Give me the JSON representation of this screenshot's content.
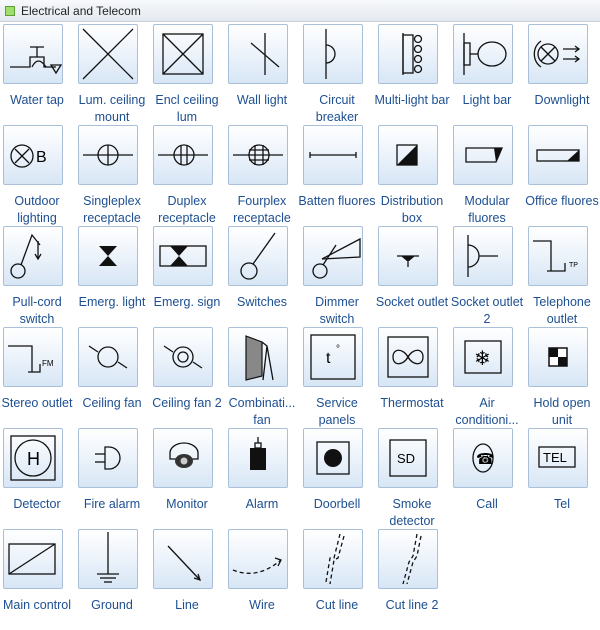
{
  "panel": {
    "title": "Electrical and Telecom"
  },
  "shapes": [
    {
      "label": "Water tap",
      "icon": "water-tap-icon"
    },
    {
      "label": "Lum. ceiling mount",
      "icon": "ceiling-mount-icon"
    },
    {
      "label": "Encl ceiling lum",
      "icon": "enclosed-ceiling-icon"
    },
    {
      "label": "Wall light",
      "icon": "wall-light-icon"
    },
    {
      "label": "Circuit breaker",
      "icon": "circuit-breaker-icon"
    },
    {
      "label": "Multi-light bar",
      "icon": "multi-light-bar-icon"
    },
    {
      "label": "Light bar",
      "icon": "light-bar-icon"
    },
    {
      "label": "Downlight",
      "icon": "downlight-icon"
    },
    {
      "label": "Outdoor lighting",
      "icon": "outdoor-lighting-icon"
    },
    {
      "label": "Singleplex receptacle",
      "icon": "singleplex-receptacle-icon"
    },
    {
      "label": "Duplex receptacle",
      "icon": "duplex-receptacle-icon"
    },
    {
      "label": "Fourplex receptacle",
      "icon": "fourplex-receptacle-icon"
    },
    {
      "label": "Batten fluores",
      "icon": "batten-fluores-icon"
    },
    {
      "label": "Distribution box",
      "icon": "distribution-box-icon"
    },
    {
      "label": "Modular fluores",
      "icon": "modular-fluores-icon"
    },
    {
      "label": "Office fluores",
      "icon": "office-fluores-icon"
    },
    {
      "label": "Pull-cord switch",
      "icon": "pull-cord-switch-icon"
    },
    {
      "label": "Emerg. light",
      "icon": "emergency-light-icon"
    },
    {
      "label": "Emerg. sign",
      "icon": "emergency-sign-icon"
    },
    {
      "label": "Switches",
      "icon": "switches-icon"
    },
    {
      "label": "Dimmer switch",
      "icon": "dimmer-switch-icon"
    },
    {
      "label": "Socket outlet",
      "icon": "socket-outlet-icon"
    },
    {
      "label": "Socket outlet 2",
      "icon": "socket-outlet-2-icon"
    },
    {
      "label": "Telephone outlet",
      "icon": "telephone-outlet-icon",
      "text": "TP"
    },
    {
      "label": "Stereo outlet",
      "icon": "stereo-outlet-icon",
      "text": "FM"
    },
    {
      "label": "Ceiling fan",
      "icon": "ceiling-fan-icon"
    },
    {
      "label": "Ceiling fan 2",
      "icon": "ceiling-fan-2-icon"
    },
    {
      "label": "Combinati... fan",
      "icon": "combination-fan-icon"
    },
    {
      "label": "Service panels",
      "icon": "service-panels-icon",
      "text": "t",
      "text2": "°"
    },
    {
      "label": "Thermostat",
      "icon": "thermostat-icon"
    },
    {
      "label": "Air conditioni...",
      "icon": "air-conditioning-icon",
      "text": "❄"
    },
    {
      "label": "Hold open unit",
      "icon": "hold-open-unit-icon"
    },
    {
      "label": "Detector",
      "icon": "detector-icon",
      "text": "H"
    },
    {
      "label": "Fire alarm",
      "icon": "fire-alarm-icon"
    },
    {
      "label": "Monitor",
      "icon": "monitor-icon"
    },
    {
      "label": "Alarm",
      "icon": "alarm-icon"
    },
    {
      "label": "Doorbell",
      "icon": "doorbell-icon"
    },
    {
      "label": "Smoke detector",
      "icon": "smoke-detector-icon",
      "text": "SD"
    },
    {
      "label": "Call",
      "icon": "call-icon",
      "text": "☎"
    },
    {
      "label": "Tel",
      "icon": "tel-icon",
      "text": "TEL"
    },
    {
      "label": "Main control",
      "icon": "main-control-icon"
    },
    {
      "label": "Ground",
      "icon": "ground-icon"
    },
    {
      "label": "Line",
      "icon": "line-icon"
    },
    {
      "label": "Wire",
      "icon": "wire-icon"
    },
    {
      "label": "Cut line",
      "icon": "cut-line-icon"
    },
    {
      "label": "Cut line 2",
      "icon": "cut-line-2-icon"
    }
  ]
}
